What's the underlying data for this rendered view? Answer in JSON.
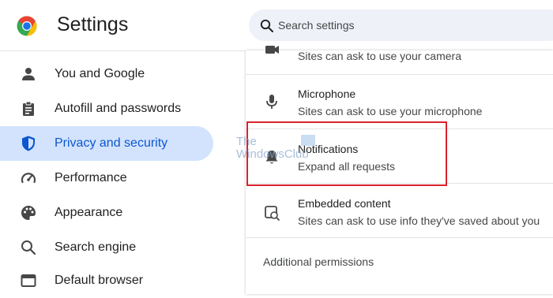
{
  "header": {
    "title": "Settings",
    "search_placeholder": "Search settings",
    "logo_icon": "chrome-logo"
  },
  "sidebar": {
    "items": [
      {
        "label": "You and Google",
        "icon": "person-icon",
        "active": false
      },
      {
        "label": "Autofill and passwords",
        "icon": "clipboard-icon",
        "active": false
      },
      {
        "label": "Privacy and security",
        "icon": "shield-icon",
        "active": true
      },
      {
        "label": "Performance",
        "icon": "speedometer-icon",
        "active": false
      },
      {
        "label": "Appearance",
        "icon": "palette-icon",
        "active": false
      },
      {
        "label": "Search engine",
        "icon": "search-icon",
        "active": false
      },
      {
        "label": "Default browser",
        "icon": "browser-window-icon",
        "active": false
      }
    ]
  },
  "content": {
    "rows": [
      {
        "title": "",
        "subtitle": "Sites can ask to use your camera",
        "icon": "camera-icon"
      },
      {
        "title": "Microphone",
        "subtitle": "Sites can ask to use your microphone",
        "icon": "microphone-icon"
      },
      {
        "title": "Notifications",
        "subtitle": "Expand all requests",
        "icon": "bell-icon"
      },
      {
        "title": "Embedded content",
        "subtitle": "Sites can ask to use info they've saved about you",
        "icon": "embedded-content-icon"
      }
    ],
    "section_heading": "Additional permissions"
  },
  "watermark": {
    "line1": "The",
    "line2": "WindowsClub"
  },
  "colors": {
    "accent": "#0b57d0",
    "active_background": "#d3e3fd",
    "search_background": "#eef1f8",
    "highlight_border": "#d9232e"
  }
}
